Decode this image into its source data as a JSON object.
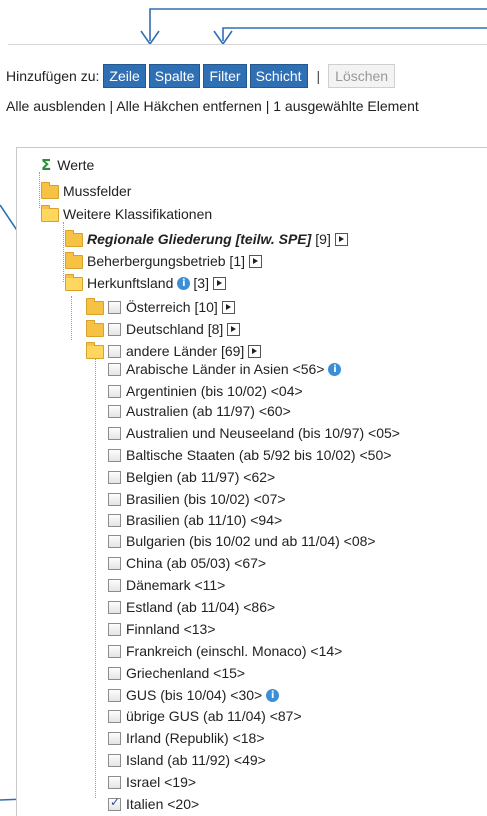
{
  "toolbar": {
    "label": "Hinzufügen zu:",
    "buttons": [
      "Zeile",
      "Spalte",
      "Filter",
      "Schicht"
    ],
    "separator": "|",
    "delete_label": "Löschen"
  },
  "links": {
    "text": "Alle ausblenden | Alle Häkchen entfernen | 1 ausgewählte Element"
  },
  "tree": {
    "werte": "Werte",
    "mussfelder": "Mussfelder",
    "weitere": "Weitere Klassifikationen",
    "regionale": "Regionale Gliederung [teilw. SPE]",
    "regionale_count": "[9]",
    "beherbergung": "Beherbergungsbetrieb [1]",
    "herkunft": "Herkunftsland",
    "herkunft_count": "[3]",
    "oesterreich": "Österreich [10]",
    "deutschland": "Deutschland [8]",
    "andere": "andere Länder [69]",
    "countries": [
      "Arabische Länder in Asien <56>",
      "Argentinien (bis 10/02) <04>",
      "Australien (ab 11/97) <60>",
      "Australien und Neuseeland (bis 10/97) <05>",
      "Baltische Staaten (ab 5/92 bis 10/02) <50>",
      "Belgien (ab 11/97) <62>",
      "Brasilien (bis 10/02) <07>",
      "Brasilien (ab 11/10) <94>",
      "Bulgarien (bis 10/02 und ab 11/04) <08>",
      "China (ab 05/03) <67>",
      "Dänemark <11>",
      "Estland (ab 11/04) <86>",
      "Finnland <13>",
      "Frankreich (einschl. Monaco) <14>",
      "Griechenland <15>",
      "GUS (bis 10/04) <30>",
      "übrige GUS (ab 11/04) <87>",
      "Irland (Republik) <18>",
      "Island (ab 11/92) <49>",
      "Israel <19>",
      "Italien <20>"
    ]
  },
  "icons": {
    "sigma": "Σ",
    "info": "i"
  },
  "colors": {
    "button_bg": "#2f6fb4",
    "arrow": "#2f6fb4",
    "folder": "#f6c244",
    "sigma": "#2e8b3a",
    "info": "#3b8fd6"
  }
}
